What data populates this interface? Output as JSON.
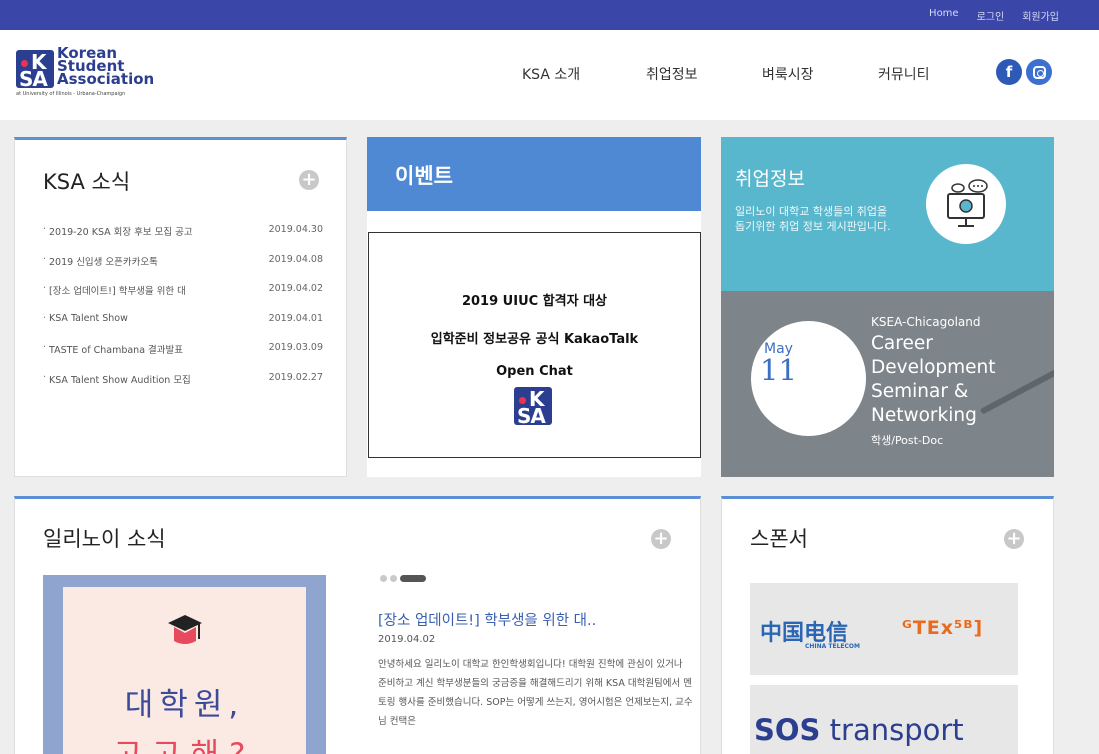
{
  "topbar": {
    "home": "Home",
    "login": "로그인",
    "signup": "회원가입"
  },
  "logo": {
    "line1": "Korean",
    "line2": "Student",
    "line3": "Association",
    "sub": "at University of Illinois - Urbana-Champaign",
    "mark_k": "K",
    "mark_sa": "SA"
  },
  "nav": {
    "items": [
      "KSA 소개",
      "취업정보",
      "벼룩시장",
      "커뮤니티"
    ],
    "facebook": "f"
  },
  "news": {
    "title": "KSA 소식",
    "more": "+",
    "items": [
      {
        "title": "2019-20 KSA 회장 후보 모집 공고",
        "date": "2019.04.30"
      },
      {
        "title": "2019 신입생 오픈카카오톡",
        "date": "2019.04.08"
      },
      {
        "title": "[장소 업데이트!] 학부생을 위한 대",
        "date": "2019.04.02"
      },
      {
        "title": "KSA Talent Show",
        "date": "2019.04.01"
      },
      {
        "title": "TASTE of Chambana 결과발표",
        "date": "2019.03.09"
      },
      {
        "title": "KSA Talent Show Audition 모집",
        "date": "2019.02.27"
      }
    ]
  },
  "event": {
    "title": "이벤트",
    "line1": "2019 UIUC 합격자 대상",
    "line2": "입학준비 정보공유 공식 KakaoTalk",
    "line3": "Open Chat"
  },
  "jobs": {
    "title": "취업정보",
    "desc": "일리노이 대학교 학생들의 취업을 돕기위한 취업 정보 게시판입니다."
  },
  "seminar": {
    "month": "May",
    "day": "11",
    "org": "KSEA-Chicagoland",
    "line1": "Career",
    "line2": "Development",
    "line3": "Seminar &",
    "line4": "Networking",
    "audience": "학생/Post-Doc"
  },
  "illinois": {
    "title": "일리노이 소식",
    "more": "+",
    "image_text1": "대학원,",
    "image_text2": "고고해?",
    "article_title": "[장소 업데이트!] 학부생을 위한 대..",
    "article_date": "2019.04.02",
    "article_body": "안녕하세요 일리노이 대학교 한인학생회입니다! 대학원 진학에 관심이 있거나 준비하고 계신 학부생분들의 궁금증을 해결해드리기 위해 KSA 대학원팀에서 멘토링 행사를 준비했습니다. SOP는 어떻게 쓰는지, 영어시험은 언제보는지, 교수님 컨택은"
  },
  "sponsor": {
    "title": "스폰서",
    "more": "+",
    "ct_name": "中国电信",
    "ct_sub": "CHINA TELECOM",
    "tex": "ᴳTEx⁵ᴮ]",
    "sos_bold": "SOS",
    "sos_rest": " transport"
  },
  "colors": {
    "topbar": "#3b47a8",
    "accent": "#4f89d3",
    "jobs": "#59b7cd",
    "seminar": "#7d858b"
  }
}
